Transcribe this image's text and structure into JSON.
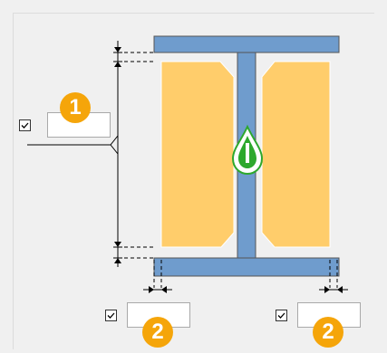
{
  "colors": {
    "steel": "#6f9ccd",
    "insulation": "#ffcd6b",
    "badge": "#f5a50a",
    "icon_green": "#2da82d"
  },
  "controls": {
    "top_bottom_thickness": {
      "checked": true,
      "value": "",
      "badge": "1"
    },
    "left_gap": {
      "checked": true,
      "value": "",
      "badge": "2"
    },
    "right_gap": {
      "checked": true,
      "value": "",
      "badge": "2"
    }
  },
  "icons": {
    "check": "checkmark-icon",
    "center": "drop-icon"
  }
}
